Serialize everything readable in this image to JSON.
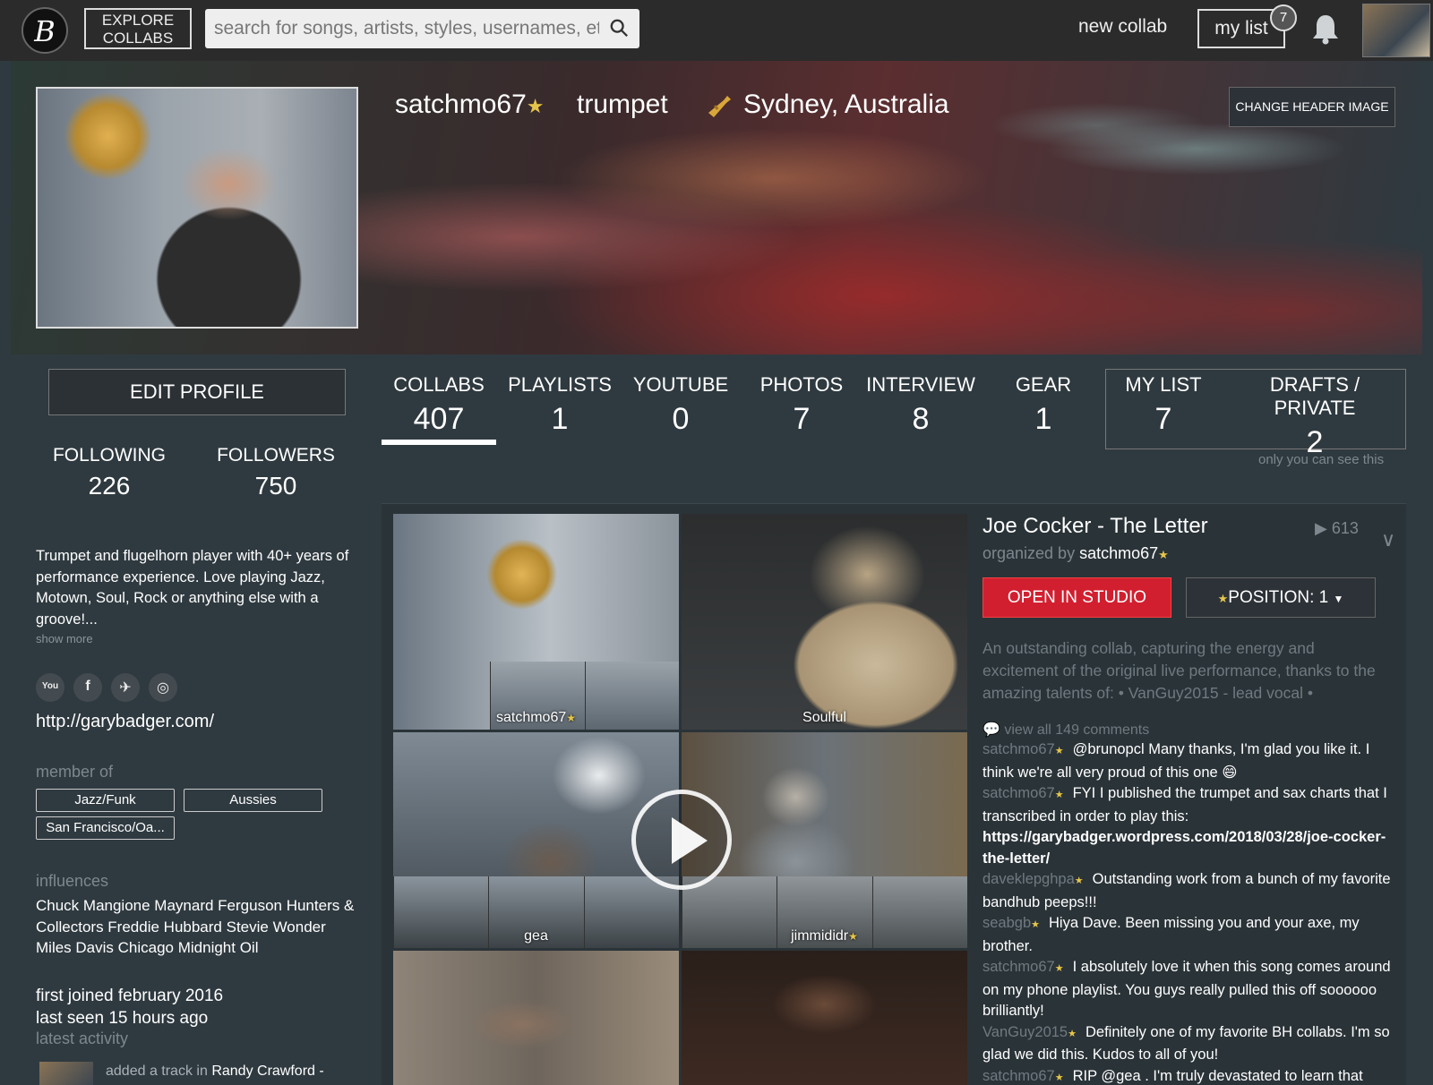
{
  "nav": {
    "logo": "B",
    "explore_line1": "EXPLORE",
    "explore_line2": "COLLABS",
    "search_placeholder": "search for songs, artists, styles, usernames, etc.",
    "new_collab": "new collab",
    "my_list": "my list",
    "my_list_count": "7"
  },
  "header": {
    "username": "satchmo67",
    "instrument": "trumpet",
    "location": "Sydney, Australia",
    "change_header": "CHANGE HEADER IMAGE"
  },
  "profile": {
    "edit_profile": "EDIT PROFILE",
    "following_label": "FOLLOWING",
    "following": "226",
    "followers_label": "FOLLOWERS",
    "followers": "750",
    "bio": "Trumpet and flugelhorn player with 40+ years of performance experience. Love playing Jazz, Motown, Soul, Rock or anything else with a groove!...",
    "show_more": "show more",
    "website": "http://garybadger.com/",
    "member_of_label": "member of",
    "groups": [
      "Jazz/Funk",
      "Aussies",
      "San Francisco/Oa..."
    ],
    "influences_label": "influences",
    "influences": "Chuck Mangione Maynard Ferguson Hunters & Collectors Freddie Hubbard Stevie Wonder Miles Davis Chicago Midnight Oil",
    "first_joined": "first joined february 2016",
    "last_seen": "last seen 15 hours ago",
    "latest_activity_label": "latest activity",
    "activity_prefix": "added a track in",
    "activity_target": "Randy Crawford -"
  },
  "tabs": [
    {
      "label": "COLLABS",
      "count": "407",
      "active": true
    },
    {
      "label": "PLAYLISTS",
      "count": "1"
    },
    {
      "label": "YOUTUBE",
      "count": "0"
    },
    {
      "label": "PHOTOS",
      "count": "7"
    },
    {
      "label": "INTERVIEW",
      "count": "8"
    },
    {
      "label": "GEAR",
      "count": "1"
    },
    {
      "label": "MY LIST",
      "count": "7"
    },
    {
      "label": "DRAFTS / PRIVATE",
      "count": "2"
    }
  ],
  "private_note": "only you can see this",
  "collab": {
    "title": "Joe Cocker - The Letter",
    "plays": "613",
    "organized_by": "organized by",
    "organizer": "satchmo67",
    "open_studio": "OPEN IN STUDIO",
    "position": "POSITION: 1",
    "description": "An outstanding collab, capturing the energy and excitement of the original live performance, thanks to the amazing talents of: • VanGuy2015 - lead vocal •",
    "view_comments": "view all 149 comments",
    "tracks": [
      {
        "name": "satchmo67",
        "star": true
      },
      {
        "name": "Soulful",
        "star": false
      },
      {
        "name": "gea",
        "star": false
      },
      {
        "name": "jimmididr",
        "star": true
      },
      {
        "name": "",
        "star": false
      },
      {
        "name": "",
        "star": false
      }
    ],
    "comments": [
      {
        "user": "satchmo67",
        "text": "@brunopcl Many thanks, I'm glad you like it. I think we're all very proud of this one 😄"
      },
      {
        "user": "satchmo67",
        "text": "FYI I published the trumpet and sax charts that I transcribed in order to play this:",
        "link": "https://garybadger.wordpress.com/2018/03/28/joe-cocker-the-letter/"
      },
      {
        "user": "daveklepghpa",
        "text": "Outstanding work from a bunch of my favorite bandhub peeps!!!"
      },
      {
        "user": "seabgb",
        "text": "Hiya Dave. Been missing you and your axe, my brother."
      },
      {
        "user": "satchmo67",
        "text": "I absolutely love it when this song comes around on my phone playlist. You guys really pulled this off soooooo brilliantly!"
      },
      {
        "user": "VanGuy2015",
        "text": "Definitely one of my favorite BH collabs. I'm so glad we did this. Kudos to all of you!"
      },
      {
        "user": "satchmo67",
        "text": "RIP @gea . I'm truly devastated to learn that we've lost you. This is one of my favorite recordings"
      }
    ]
  },
  "colors": {
    "accent_red": "#d21f2f",
    "star": "#e6c64a",
    "background": "#2f3a40",
    "nav": "#2b2b2b"
  }
}
